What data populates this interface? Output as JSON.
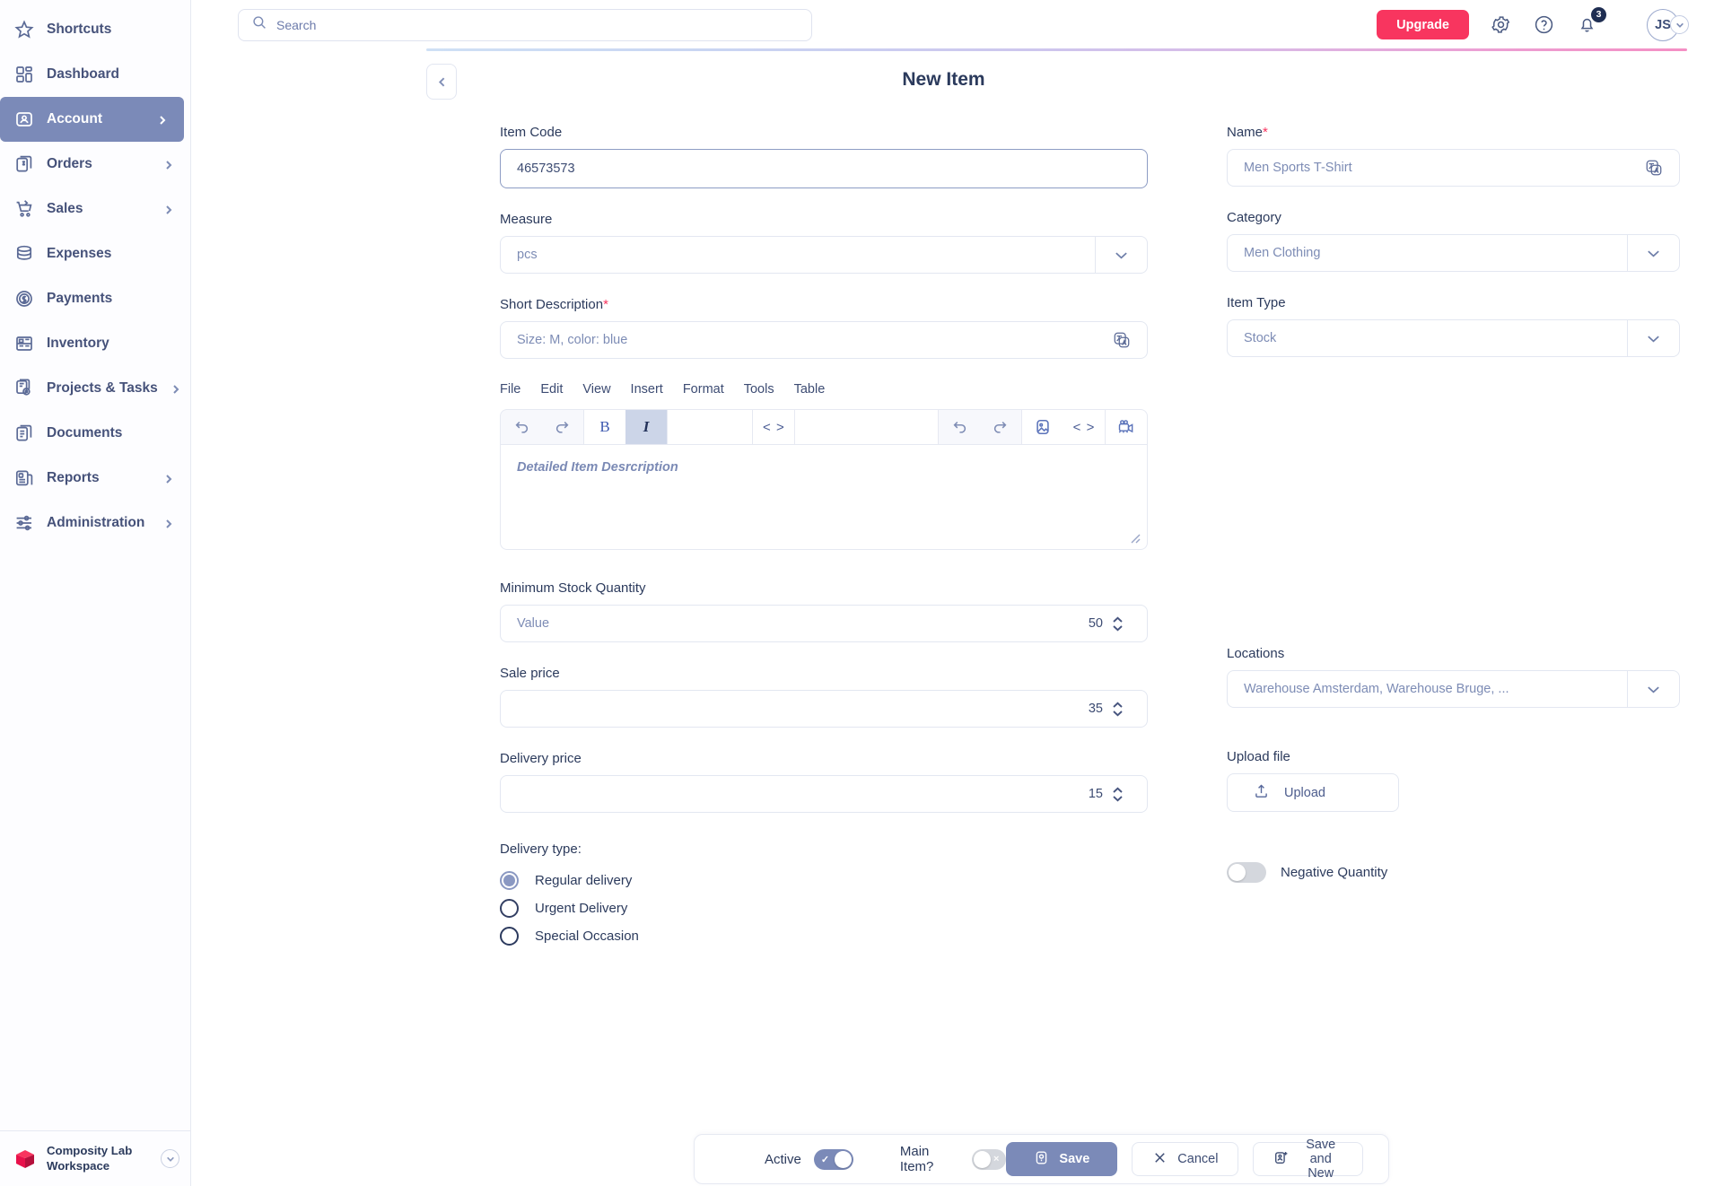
{
  "sidebar": {
    "items": [
      {
        "label": "Shortcuts",
        "icon": "star-icon",
        "chevron": false,
        "active": false
      },
      {
        "label": "Dashboard",
        "icon": "dashboard-icon",
        "chevron": false,
        "active": false
      },
      {
        "label": "Account",
        "icon": "account-icon",
        "chevron": true,
        "active": true
      },
      {
        "label": "Orders",
        "icon": "orders-icon",
        "chevron": true,
        "active": false
      },
      {
        "label": "Sales",
        "icon": "cart-icon",
        "chevron": true,
        "active": false
      },
      {
        "label": "Expenses",
        "icon": "database-icon",
        "chevron": false,
        "active": false
      },
      {
        "label": "Payments",
        "icon": "coin-icon",
        "chevron": false,
        "active": false
      },
      {
        "label": "Inventory",
        "icon": "shelf-icon",
        "chevron": false,
        "active": false
      },
      {
        "label": "Projects & Tasks",
        "icon": "projects-gear-icon",
        "chevron": true,
        "active": false
      },
      {
        "label": "Documents",
        "icon": "document-icon",
        "chevron": false,
        "active": false
      },
      {
        "label": "Reports",
        "icon": "reports-icon",
        "chevron": true,
        "active": false
      },
      {
        "label": "Administration",
        "icon": "sliders-icon",
        "chevron": true,
        "active": false
      }
    ],
    "workspace": {
      "name": "Composity Lab Workspace",
      "logo": "composity-logo",
      "chevron_icon": "chevron-down-icon"
    }
  },
  "topbar": {
    "search_placeholder": "Search",
    "search_value": "",
    "search_icon": "search-icon",
    "upgrade_label": "Upgrade",
    "settings_icon": "gear-icon",
    "help_icon": "question-circle-icon",
    "notifications_icon": "bell-icon",
    "notification_count": "3",
    "avatar_initials": "JS",
    "avatar_chevron_icon": "chevron-down-icon"
  },
  "page": {
    "title": "New Item",
    "back_icon": "chevron-left-icon"
  },
  "form": {
    "item_code": {
      "label": "Item Code",
      "value": "46573573",
      "placeholder": ""
    },
    "name": {
      "label": "Name",
      "required": "*",
      "value": "",
      "placeholder": "Men Sports T-Shirt",
      "trailing_icon": "translate-icon"
    },
    "measure": {
      "label": "Measure",
      "value": "",
      "placeholder": "pcs",
      "chevron_icon": "chevron-down-icon"
    },
    "category": {
      "label": "Category",
      "value": "",
      "placeholder": "Men Clothing",
      "chevron_icon": "chevron-down-icon"
    },
    "short_description": {
      "label": "Short Description",
      "required": "*",
      "value": "",
      "placeholder": "Size: M, color: blue",
      "trailing_icon": "translate-icon"
    },
    "item_type": {
      "label": "Item Type",
      "value": "",
      "placeholder": "Stock",
      "chevron_icon": "chevron-down-icon"
    },
    "min_stock": {
      "label": "Minimum Stock Quantity",
      "placeholder": "Value",
      "value": "50",
      "stepper_icon": "stepper-updown-icon"
    },
    "sale_price": {
      "label": "Sale price",
      "placeholder": "",
      "value": "35",
      "stepper_icon": "stepper-updown-icon"
    },
    "delivery_price": {
      "label": "Delivery price",
      "placeholder": "",
      "value": "15",
      "stepper_icon": "stepper-updown-icon"
    },
    "locations": {
      "label": "Locations",
      "value": "",
      "placeholder": "Warehouse Amsterdam, Warehouse Bruge, ...",
      "chevron_icon": "chevron-down-icon"
    },
    "upload": {
      "label": "Upload file",
      "button_label": "Upload",
      "icon": "upload-icon"
    },
    "negative_quantity": {
      "label": "Negative Quantity",
      "state": "off"
    },
    "delivery_type": {
      "title": "Delivery type:",
      "options": [
        {
          "label": "Regular delivery",
          "selected": true
        },
        {
          "label": "Urgent Delivery",
          "selected": false
        },
        {
          "label": "Special Occasion",
          "selected": false
        }
      ]
    }
  },
  "editor": {
    "menu": [
      "File",
      "Edit",
      "View",
      "Insert",
      "Format",
      "Tools",
      "Table"
    ],
    "placeholder": "Detailed Item Desrcription",
    "toolbar": [
      {
        "icon": "undo-icon"
      },
      {
        "icon": "redo-icon"
      },
      {
        "icon": "bold-icon",
        "glyph": "B"
      },
      {
        "icon": "italic-icon",
        "glyph": "I",
        "active": true
      },
      {
        "icon": "code-icon",
        "glyph": "< >"
      },
      {
        "icon": "undo-icon"
      },
      {
        "icon": "redo-icon"
      },
      {
        "icon": "image-icon"
      },
      {
        "icon": "code-icon",
        "glyph": "< >"
      },
      {
        "icon": "video-camera-icon"
      }
    ],
    "resize_icon": "resize-handle-icon"
  },
  "bottombar": {
    "active": {
      "label": "Active",
      "state": "on",
      "mark": "✓"
    },
    "main_item": {
      "label": "Main Item?",
      "state": "off",
      "mark": "×"
    },
    "save": {
      "label": "Save",
      "icon": "save-icon"
    },
    "cancel": {
      "label": "Cancel",
      "icon": "close-icon"
    },
    "save_and_new": {
      "label": "Save and New",
      "icon": "save-new-icon"
    }
  },
  "colors": {
    "accent_pink": "#f8355f",
    "accent_blue": "#7b8ab8",
    "text_dark": "#2b3a5c",
    "border": "#e3e7f1"
  }
}
